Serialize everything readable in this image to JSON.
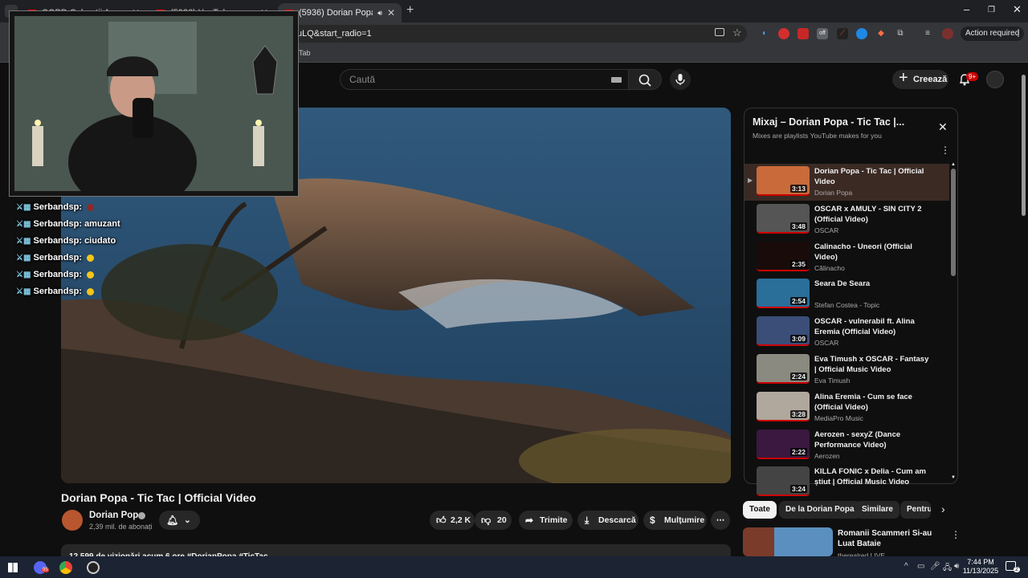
{
  "browser": {
    "tabs": [
      {
        "label": "COPD Celaretii Apocalipsei de"
      },
      {
        "label": "(5936) YouTube"
      },
      {
        "label": "(5936) Dorian Popa - Tic Tac"
      }
    ],
    "url_fragment": "uLQ&start_radio=1",
    "bookmark_item": "Tab",
    "action_required": "Action required"
  },
  "header": {
    "search_placeholder": "Caută",
    "create_label": "Creează",
    "notif_count": "9+"
  },
  "video": {
    "title": "Dorian Popa - Tic Tac | Official Video",
    "channel": "Dorian Popa",
    "subscribers": "2,39 mil. de abonați",
    "likes": "2,2 K",
    "dislikes": "20",
    "share_label": "Trimite",
    "download_label": "Descarcă",
    "thanks_label": "Mulțumire",
    "description": "12.599 de vizionări  acum 6 ore  #DorianPopa #TicTac"
  },
  "playlist": {
    "title": "Mixaj – Dorian Popa - Tic Tac |...",
    "subtitle": "Mixes are playlists YouTube makes for you",
    "items": [
      {
        "title": "Dorian Popa - Tic Tac | Official Video",
        "artist": "Dorian Popa",
        "duration": "3:13",
        "color": "#c96a3a"
      },
      {
        "title": "OSCAR x AMULY - SIN CITY 2 (Official Video)",
        "artist": "OSCAR",
        "duration": "3:48",
        "color": "#555555"
      },
      {
        "title": "Calinacho - Uneori (Official Video)",
        "artist": "Călinacho",
        "duration": "2:35",
        "color": "#1a0b0b"
      },
      {
        "title": "Seara De Seara",
        "artist": "Stefan Costea - Topic",
        "duration": "2:54",
        "color": "#2a6e9a"
      },
      {
        "title": "OSCAR - vulnerabil ft. Alina Eremia (Official Video)",
        "artist": "OSCAR",
        "duration": "3:09",
        "color": "#3a4e78"
      },
      {
        "title": "Eva Timush x OSCAR - Fantasy | Official Music Video",
        "artist": "Eva Timush",
        "duration": "2:24",
        "color": "#8a8a80"
      },
      {
        "title": "Alina Eremia - Cum se face (Official Video)",
        "artist": "MediaPro Music",
        "duration": "3:28",
        "color": "#b0a89c"
      },
      {
        "title": "Aerozen - sexyZ (Dance Performance Video)",
        "artist": "Aerozen",
        "duration": "2:22",
        "color": "#3a1840"
      },
      {
        "title": "KILLA FONIC x Delia - Cum am știut | Official Music Video",
        "artist": "",
        "duration": "3:24",
        "color": "#444444"
      }
    ]
  },
  "chips": [
    "Toate",
    "De la Dorian Popa",
    "Similare",
    "Pentru"
  ],
  "recommendation": {
    "title": "Romanii Scammeri Si-au Luat Bataie",
    "channel": "therealred LIVE"
  },
  "chat": [
    {
      "user": "Serbandsp:",
      "text": ""
    },
    {
      "user": "Serbandsp:",
      "text": "amuzant"
    },
    {
      "user": "Serbandsp:",
      "text": "ciudato"
    },
    {
      "user": "Serbandsp:",
      "text": ""
    },
    {
      "user": "Serbandsp:",
      "text": ""
    },
    {
      "user": "Serbandsp:",
      "text": ""
    }
  ],
  "taskbar": {
    "time": "7:44 PM",
    "date": "11/13/2025",
    "notif_count": "2",
    "discord_badge": "95"
  }
}
